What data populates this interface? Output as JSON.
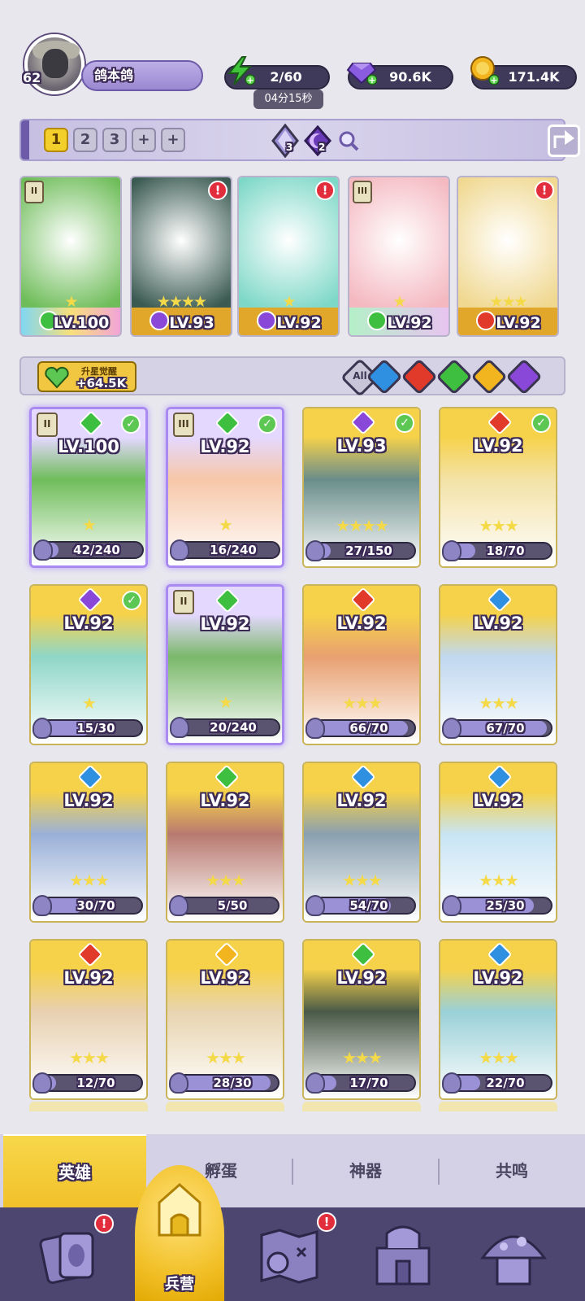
{
  "player": {
    "level": "62",
    "name": "鸽本鸽"
  },
  "resources": {
    "energy": {
      "value": "2/60",
      "timer": "04分15秒",
      "color": "#3fc43a"
    },
    "gems": {
      "value": "90.6K",
      "color": "#8a5ce0"
    },
    "gold": {
      "value": "171.4K",
      "color": "#f2b51f"
    }
  },
  "team_bar": {
    "slots": [
      "1",
      "2",
      "3",
      "+",
      "+"
    ],
    "active_slot": "1",
    "crystal_count": "3",
    "moon_count": "2"
  },
  "lineup": [
    {
      "level": "LV.100",
      "element": "nature",
      "tier": "II",
      "alert": false,
      "stars": "★"
    },
    {
      "level": "LV.93",
      "element": "dark",
      "tier": "",
      "alert": true,
      "stars": "★★★★"
    },
    {
      "level": "LV.92",
      "element": "dark",
      "tier": "",
      "alert": true,
      "stars": "★"
    },
    {
      "level": "LV.92",
      "element": "nature",
      "tier": "III",
      "alert": false,
      "stars": "★"
    },
    {
      "level": "LV.92",
      "element": "fire",
      "tier": "",
      "alert": true,
      "stars": "★★★"
    }
  ],
  "filter_bar": {
    "awaken_label": "升星觉醒",
    "awaken_value": "+64.5K",
    "all_label": "All",
    "element_filters": [
      "water",
      "fire",
      "nature",
      "light",
      "dark"
    ]
  },
  "heroes": [
    {
      "level": "LV.100",
      "element": "nature",
      "tier": "II",
      "checked": true,
      "selected": true,
      "stars": "★",
      "progress": "42/240",
      "fraction": 0.175
    },
    {
      "level": "LV.92",
      "element": "nature",
      "tier": "III",
      "checked": true,
      "selected": true,
      "stars": "★",
      "progress": "16/240",
      "fraction": 0.067
    },
    {
      "level": "LV.93",
      "element": "dark",
      "tier": "",
      "checked": true,
      "selected": false,
      "stars": "★★★★",
      "progress": "27/150",
      "fraction": 0.18
    },
    {
      "level": "LV.92",
      "element": "fire",
      "tier": "",
      "checked": true,
      "selected": false,
      "stars": "★★★",
      "progress": "18/70",
      "fraction": 0.257
    },
    {
      "level": "LV.92",
      "element": "dark",
      "tier": "",
      "checked": true,
      "selected": false,
      "stars": "★",
      "progress": "15/30",
      "fraction": 0.5
    },
    {
      "level": "LV.92",
      "element": "nature",
      "tier": "II",
      "checked": false,
      "selected": true,
      "stars": "★",
      "progress": "20/240",
      "fraction": 0.083
    },
    {
      "level": "LV.92",
      "element": "fire",
      "tier": "",
      "checked": false,
      "selected": false,
      "stars": "★★★",
      "progress": "66/70",
      "fraction": 0.943
    },
    {
      "level": "LV.92",
      "element": "water",
      "tier": "",
      "checked": false,
      "selected": false,
      "stars": "★★★",
      "progress": "67/70",
      "fraction": 0.957
    },
    {
      "level": "LV.92",
      "element": "water",
      "tier": "",
      "checked": false,
      "selected": false,
      "stars": "★★★",
      "progress": "30/70",
      "fraction": 0.429
    },
    {
      "level": "LV.92",
      "element": "nature",
      "tier": "",
      "checked": false,
      "selected": false,
      "stars": "★★★",
      "progress": "5/50",
      "fraction": 0.1
    },
    {
      "level": "LV.92",
      "element": "water",
      "tier": "",
      "checked": false,
      "selected": false,
      "stars": "★★★",
      "progress": "54/70",
      "fraction": 0.771
    },
    {
      "level": "LV.92",
      "element": "water",
      "tier": "",
      "checked": false,
      "selected": false,
      "stars": "★★★",
      "progress": "25/30",
      "fraction": 0.833
    },
    {
      "level": "LV.92",
      "element": "fire",
      "tier": "",
      "checked": false,
      "selected": false,
      "stars": "★★★",
      "progress": "12/70",
      "fraction": 0.171
    },
    {
      "level": "LV.92",
      "element": "light",
      "tier": "",
      "checked": false,
      "selected": false,
      "stars": "★★★",
      "progress": "28/30",
      "fraction": 0.933
    },
    {
      "level": "LV.92",
      "element": "nature",
      "tier": "",
      "checked": false,
      "selected": false,
      "stars": "★★★",
      "progress": "17/70",
      "fraction": 0.243
    },
    {
      "level": "LV.92",
      "element": "water",
      "tier": "",
      "checked": false,
      "selected": false,
      "stars": "★★★",
      "progress": "22/70",
      "fraction": 0.314
    }
  ],
  "tabs": [
    "英雄",
    "孵蛋",
    "神器",
    "共鸣"
  ],
  "active_tab": "英雄",
  "nav": [
    {
      "icon": "cards-icon",
      "label": "",
      "badge": true
    },
    {
      "icon": "barracks-icon",
      "label": "兵营",
      "badge": false,
      "active": true
    },
    {
      "icon": "map-icon",
      "label": "",
      "badge": true
    },
    {
      "icon": "castle-icon",
      "label": "",
      "badge": false
    },
    {
      "icon": "mushroom-house-icon",
      "label": "",
      "badge": false
    }
  ],
  "element_colors": {
    "nature": "#3fbf3f",
    "dark": "#8a48d8",
    "fire": "#e23a2a",
    "water": "#2f8fe0",
    "light": "#f2b51f"
  }
}
